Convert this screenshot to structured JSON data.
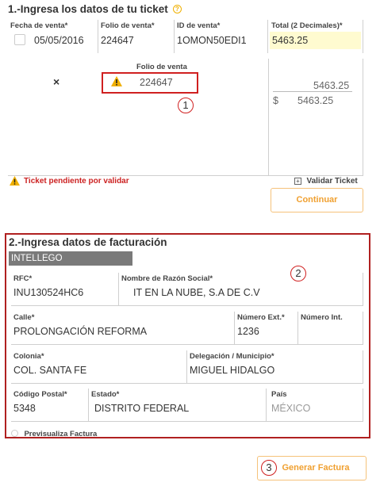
{
  "section1": {
    "title": "1.-Ingresa los datos de tu ticket",
    "help_icon": "question-circle-icon",
    "headers": {
      "fecha": "Fecha de venta*",
      "folio": "Folio de venta*",
      "id": "ID de venta*",
      "total": "Total (2 Decimales)*"
    },
    "values": {
      "fecha": "05/05/2016",
      "folio": "224647",
      "id": "1OMON50EDI1",
      "total": "5463.25"
    },
    "list_header_folio": "Folio de venta",
    "row": {
      "remove_icon": "×",
      "folio": "224647",
      "amount": "5463.25",
      "currency": "$",
      "total": "5463.25"
    },
    "pending_text": "Ticket pendiente por validar",
    "validate_label": "Validar Ticket",
    "continue_label": "Continuar",
    "callout": "1"
  },
  "section2": {
    "title": "2.-Ingresa datos de facturación",
    "company_tag": "INTELLEGO",
    "callout": "2",
    "rfc_label": "RFC*",
    "rfc_value": "INU130524HC6",
    "razon_label": "Nombre de Razón Social*",
    "razon_value": "IT EN LA NUBE, S.A DE C.V",
    "calle_label": "Calle*",
    "calle_value": "PROLONGACIÓN REFORMA",
    "num_ext_label": "Número Ext.*",
    "num_ext_value": "1236",
    "num_int_label": "Número Int.",
    "num_int_value": "",
    "colonia_label": "Colonia*",
    "colonia_value": "COL. SANTA FE",
    "delegacion_label": "Delegación / Municipio*",
    "delegacion_value": "MIGUEL HIDALGO",
    "cp_label": "Código Postal*",
    "cp_value": "5348",
    "estado_label": "Estado*",
    "estado_value": "DISTRITO FEDERAL",
    "pais_label": "País",
    "pais_value": "MÉXICO",
    "preview_label": "Previsualiza Factura"
  },
  "footer": {
    "generate_label": "Generar Factura",
    "callout": "3"
  },
  "colors": {
    "accent": "#f0a030",
    "annotation": "#d02020",
    "warning": "#f0b000",
    "pending_text": "#cc2222",
    "total_bg": "#fffbd0",
    "company_tag_bg": "#7a7a7a"
  }
}
